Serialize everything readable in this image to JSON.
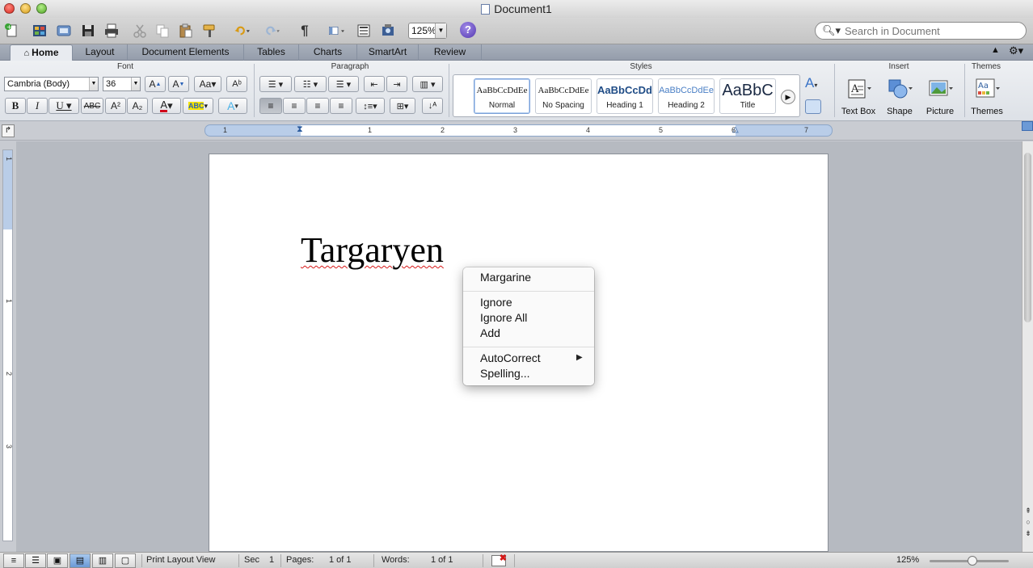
{
  "window": {
    "title": "Document1"
  },
  "toolbar": {
    "zoom": "125%",
    "search_placeholder": "Search in Document"
  },
  "tabs": [
    {
      "label": "Home",
      "icon": "home-icon",
      "active": true
    },
    {
      "label": "Layout"
    },
    {
      "label": "Document Elements"
    },
    {
      "label": "Tables"
    },
    {
      "label": "Charts"
    },
    {
      "label": "SmartArt"
    },
    {
      "label": "Review"
    }
  ],
  "ribbon": {
    "groups": {
      "font": "Font",
      "paragraph": "Paragraph",
      "styles": "Styles",
      "insert": "Insert",
      "themes": "Themes"
    },
    "font_name": "Cambria (Body)",
    "font_size": "36",
    "styles": [
      {
        "preview": "AaBbCcDdEe",
        "name": "Normal",
        "selected": true
      },
      {
        "preview": "AaBbCcDdEe",
        "name": "No Spacing"
      },
      {
        "preview": "AaBbCcDd",
        "name": "Heading 1"
      },
      {
        "preview": "AaBbCcDdEe",
        "name": "Heading 2"
      },
      {
        "preview": "AaBbC",
        "name": "Title"
      }
    ],
    "insert": {
      "text_box": "Text Box",
      "shape": "Shape",
      "picture": "Picture"
    },
    "themes_label": "Themes"
  },
  "ruler": {
    "numbers": [
      "1",
      "1",
      "2",
      "3",
      "4",
      "5",
      "6",
      "7"
    ]
  },
  "vruler": {
    "numbers": [
      "1",
      "1",
      "2",
      "3"
    ]
  },
  "document": {
    "text": "Targaryen"
  },
  "context_menu": {
    "suggestion": "Margarine",
    "ignore": "Ignore",
    "ignore_all": "Ignore All",
    "add": "Add",
    "autocorrect": "AutoCorrect",
    "spelling": "Spelling..."
  },
  "statusbar": {
    "view": "Print Layout View",
    "sec_label": "Sec",
    "sec_value": "1",
    "pages_label": "Pages:",
    "pages_value": "1 of 1",
    "words_label": "Words:",
    "words_value": "1 of 1",
    "zoom": "125%"
  },
  "colors": {
    "accent": "#6b9ad6",
    "spell_error": "#d71818",
    "font_color": "#d0021b",
    "highlight": "#f5e400"
  }
}
